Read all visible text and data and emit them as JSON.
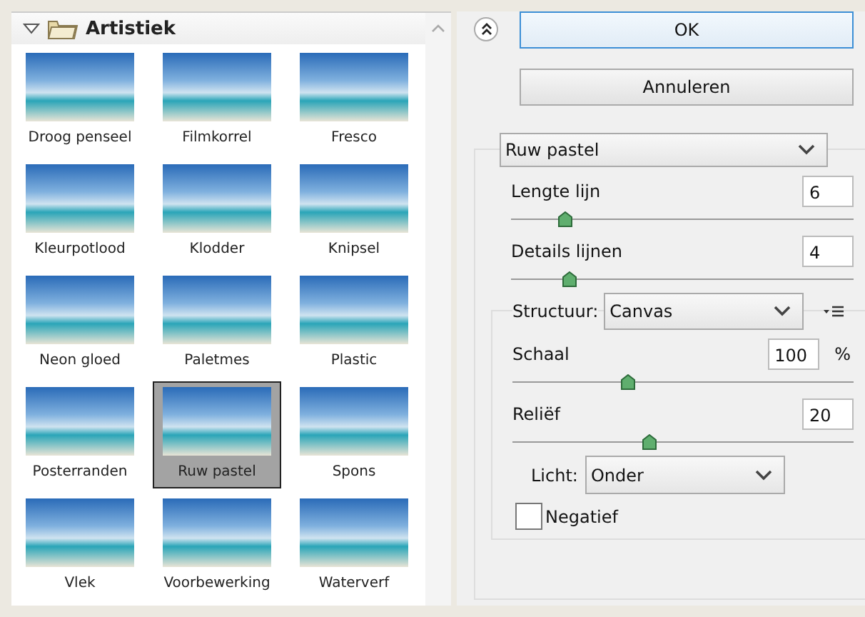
{
  "gallery": {
    "category": {
      "label": "Artistiek",
      "expanded": true
    },
    "filters": [
      {
        "label": "Droog penseel",
        "selected": false
      },
      {
        "label": "Filmkorrel",
        "selected": false
      },
      {
        "label": "Fresco",
        "selected": false
      },
      {
        "label": "Kleurpotlood",
        "selected": false
      },
      {
        "label": "Klodder",
        "selected": false
      },
      {
        "label": "Knipsel",
        "selected": false
      },
      {
        "label": "Neon gloed",
        "selected": false
      },
      {
        "label": "Paletmes",
        "selected": false
      },
      {
        "label": "Plastic",
        "selected": false
      },
      {
        "label": "Posterranden",
        "selected": false
      },
      {
        "label": "Ruw pastel",
        "selected": true
      },
      {
        "label": "Spons",
        "selected": false
      },
      {
        "label": "Vlek",
        "selected": false
      },
      {
        "label": "Voorbewerking",
        "selected": false
      },
      {
        "label": "Waterverf",
        "selected": false
      }
    ]
  },
  "buttons": [
    "OK",
    "Annuleren"
  ],
  "filter_select": {
    "value": "Ruw pastel"
  },
  "stroke_sliders": [
    {
      "label": "Lengte lijn",
      "value": "6",
      "level": 0.16
    },
    {
      "label": "Details lijnen",
      "value": "4",
      "level": 0.17
    }
  ],
  "texture": {
    "label": "Structuur:",
    "value": "Canvas",
    "sliders": [
      {
        "label": "Schaal",
        "value": "100",
        "unit": "%",
        "level": 0.34
      },
      {
        "label": "Reliëf",
        "value": "20",
        "level": 0.4
      }
    ],
    "light": {
      "label": "Licht:",
      "value": "Onder"
    },
    "invert": {
      "label": "Negatief",
      "checked": false
    }
  }
}
